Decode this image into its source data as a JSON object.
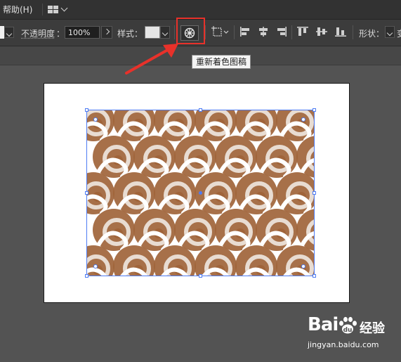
{
  "menubar": {
    "help_label": "帮助(H)",
    "workspace_icon": "layout-grid-icon"
  },
  "controlbar": {
    "opacity_label": "不透明度",
    "opacity_colon": "：",
    "opacity_value": "100%",
    "style_label": "样式",
    "style_colon": "：",
    "recolor_icon": "recolor-artwork-icon",
    "shape_label": "形状",
    "shape_colon": "：",
    "cut_text": "变"
  },
  "tooltip": {
    "text": "重新着色图稿"
  },
  "colors": {
    "highlight": "#e8312a",
    "selection": "#4d7bf3",
    "pattern_brown": "#a0643a",
    "pattern_light": "#e8dcd2"
  },
  "watermark": {
    "logo_bai": "Bai",
    "logo_du": "du",
    "jingyan": "经验",
    "url": "jingyan.baidu.com"
  }
}
